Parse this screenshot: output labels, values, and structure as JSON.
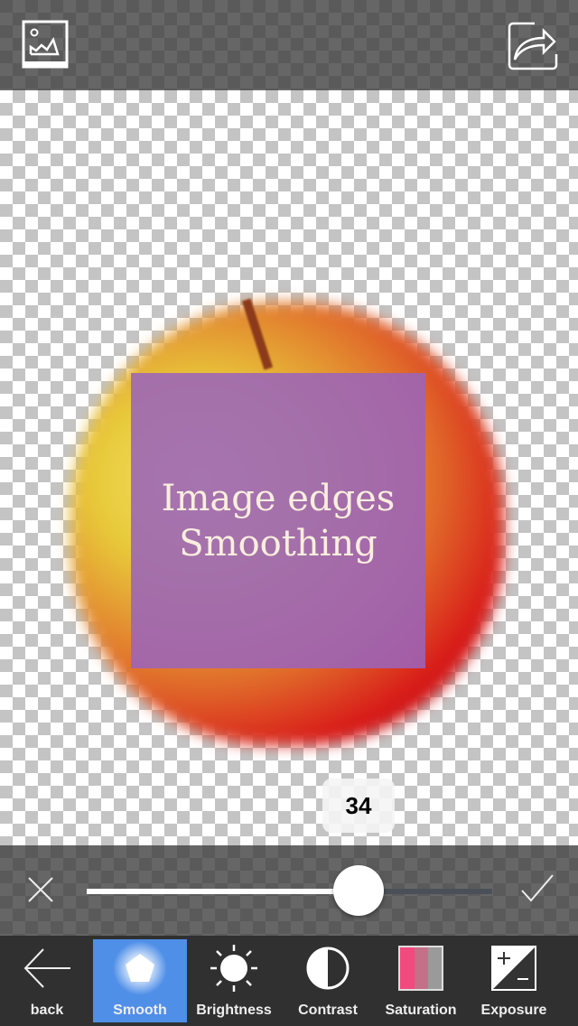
{
  "topbar": {
    "left_icon": "gallery-image-icon",
    "right_icon": "share-icon"
  },
  "canvas": {
    "overlay_line1": "Image edges",
    "overlay_line2": "Smoothing"
  },
  "slider": {
    "value": "34",
    "fill_fraction": 0.67,
    "cancel_icon": "close-icon",
    "confirm_icon": "checkmark-icon"
  },
  "toolbar": {
    "items": [
      {
        "label": "back",
        "icon": "arrow-left-icon"
      },
      {
        "label": "Smooth",
        "icon": "pentagon-icon",
        "active": true
      },
      {
        "label": "Brightness",
        "icon": "sun-icon"
      },
      {
        "label": "Contrast",
        "icon": "contrast-icon"
      },
      {
        "label": "Saturation",
        "icon": "saturation-icon"
      },
      {
        "label": "Exposure",
        "icon": "exposure-icon"
      }
    ]
  },
  "colors": {
    "accent": "#4f8fe8",
    "toolbar_bg": "#303030"
  }
}
